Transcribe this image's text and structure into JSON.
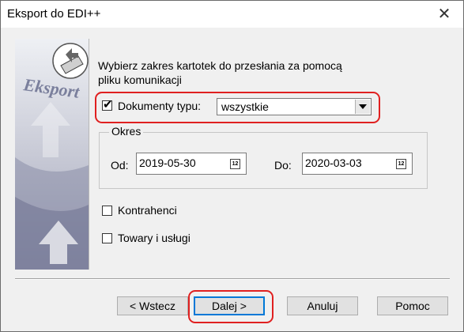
{
  "window": {
    "title": "Eksport do EDI++",
    "close_glyph": "✕"
  },
  "side_panel": {
    "brand_text": "Eksport"
  },
  "description": "Wybierz zakres kartotek do przesłania za pomocą pliku komunikacji",
  "document_types": {
    "checked": true,
    "label": "Dokumenty typu:",
    "selected": "wszystkie"
  },
  "period": {
    "legend": "Okres",
    "from_label": "Od:",
    "from_value": "2019-05-30",
    "to_label": "Do:",
    "to_value": "2020-03-03",
    "calendar_glyph": "12"
  },
  "contractors": {
    "checked": false,
    "label": "Kontrahenci"
  },
  "goods": {
    "checked": false,
    "label": "Towary i usługi"
  },
  "buttons": {
    "back": "< Wstecz",
    "next": "Dalej >",
    "cancel": "Anuluj",
    "help": "Pomoc"
  },
  "highlight_color": "#e02020",
  "icons": {
    "close": "close-icon",
    "checkbox": "checkmark-icon",
    "dropdown": "chevron-down-icon",
    "calendar": "calendar-icon"
  }
}
